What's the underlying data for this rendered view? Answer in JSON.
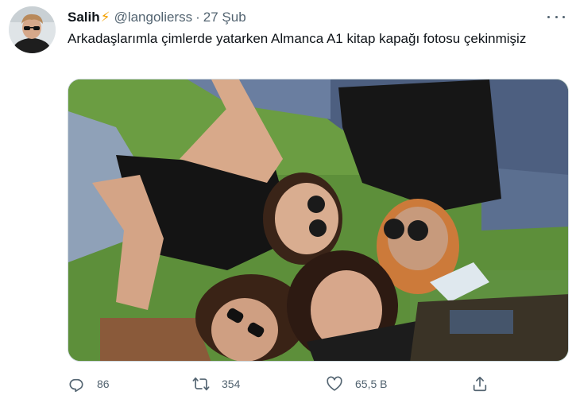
{
  "author": {
    "display_name": "Salih",
    "emoji": "⚡",
    "handle": "@langolierss",
    "separator": "·",
    "date": "27 Şub"
  },
  "tweet": {
    "text": "Arkadaşlarımla çimlerde yatarken Almanca A1 kitap  kapağı fotosu çekinmişiz"
  },
  "actions": {
    "replies": "86",
    "retweets": "354",
    "likes": "65,5 B"
  },
  "icons": {
    "more": "more-horizontal-icon",
    "reply": "reply-icon",
    "retweet": "retweet-icon",
    "like": "like-icon",
    "share": "share-icon"
  },
  "colors": {
    "secondary_text": "#536471",
    "primary_text": "#0f1419",
    "bolt": "#f4a100"
  }
}
